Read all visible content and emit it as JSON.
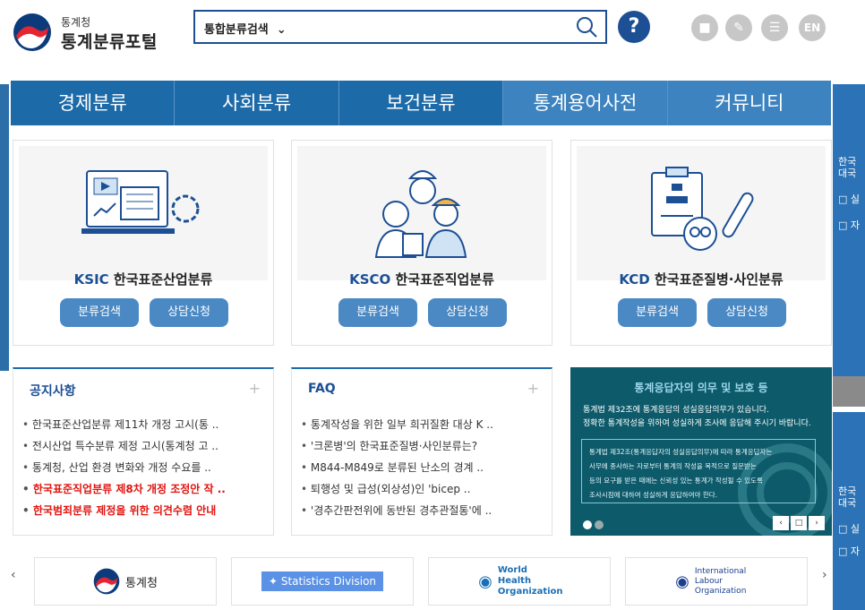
{
  "header": {
    "logo_small": "통계청",
    "logo_big": "통계분류포털",
    "search_select": "통합분류검색",
    "help_label": "?",
    "lang_label": "EN"
  },
  "nav": [
    "경제분류",
    "사회분류",
    "보건분류",
    "통계용어사전",
    "커뮤니티"
  ],
  "cards": [
    {
      "code": "KSIC",
      "name": "한국표준산업분류",
      "btn1": "분류검색",
      "btn2": "상담신청"
    },
    {
      "code": "KSCO",
      "name": "한국표준직업분류",
      "btn1": "분류검색",
      "btn2": "상담신청"
    },
    {
      "code": "KCD",
      "name": "한국표준질병·사인분류",
      "btn1": "분류검색",
      "btn2": "상담신청"
    }
  ],
  "notice": {
    "title": "공지사항",
    "items": [
      "한국표준산업분류 제11차 개정 고시(통 ..",
      "전시산업 특수분류 제정 고시(통계청 고 ..",
      "통계청, 산업 환경 변화와 개정 수요를 ..",
      "한국표준직업분류 제8차 개정 조정안 작 ..",
      "한국범죄분류 제정을 위한 의견수렴 안내"
    ]
  },
  "faq": {
    "title": "FAQ",
    "items": [
      "통계작성을 위한 일부 희귀질환 대상 K ..",
      "'크론병'의 한국표준질병·사인분류는?",
      "M844-M849로 분류된 난소의 경계 ..",
      "퇴행성 및 급성(외상성)인 'bicep ..",
      "'경추간판전위에 동반된 경추관절통'에 .."
    ]
  },
  "banner": {
    "title": "통계응답자의 의무 및 보호 등",
    "line1": "통계법 제32조에 통계응답의 성실응답의무가 있습니다.",
    "line2": "정확한 통계작성을 위하여 성실하게 조사에 응답해 주시기 바랍니다.",
    "box1": "통계법 제32조(통계응답자의 성실응답의무)에 따라 통계응답자는",
    "box2": "사무에 종사하는 자로부터 통계의 작성을 목적으로 질문받는",
    "box3": "등의 요구를 받은 때에는 신뢰성 있는 통계가 작성될 수 있도록",
    "box4": "조사시점에 대하여 성실하게 응답하여야 한다."
  },
  "right_panel": {
    "a1": "한국",
    "a2": "대국",
    "b1": "□ 실",
    "b2": "□ 자",
    "c1": "한국",
    "c2": "대국",
    "d1": "□ 실",
    "d2": "□ 자"
  },
  "partners": [
    "통계청",
    "Statistics Division",
    "World Health Organization",
    "International Labour Organization"
  ],
  "colors": {
    "nav": "#1d6aa8",
    "accent": "#1c4f94",
    "button": "#4b89c4",
    "alert": "#e0140f"
  }
}
